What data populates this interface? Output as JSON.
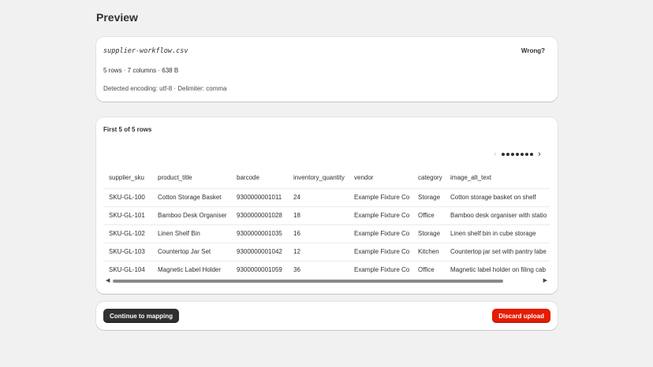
{
  "page": {
    "title": "Preview"
  },
  "file_card": {
    "filename": "supplier-workflow.csv",
    "wrong_label": "Wrong?",
    "summary": "5 rows · 7 columns · 638 B",
    "encoding": "Detected encoding: utf-8 · Delimiter: comma"
  },
  "preview_card": {
    "heading": "First 5 of 5 rows",
    "pager": {
      "prev_icon": "chevron-left-icon",
      "next_icon": "chevron-right-icon",
      "dot_count": 7
    },
    "columns": [
      "supplier_sku",
      "product_title",
      "barcode",
      "inventory_quantity",
      "vendor",
      "category",
      "image_alt_text"
    ],
    "rows": [
      [
        "SKU-GL-100",
        "Cotton Storage Basket",
        "9300000001011",
        "24",
        "Example Fixture Co",
        "Storage",
        "Cotton storage basket on shelf"
      ],
      [
        "SKU-GL-101",
        "Bamboo Desk Organiser",
        "9300000001028",
        "18",
        "Example Fixture Co",
        "Office",
        "Bamboo desk organiser with statio"
      ],
      [
        "SKU-GL-102",
        "Linen Shelf Bin",
        "9300000001035",
        "16",
        "Example Fixture Co",
        "Storage",
        "Linen shelf bin in cube storage"
      ],
      [
        "SKU-GL-103",
        "Countertop Jar Set",
        "9300000001042",
        "12",
        "Example Fixture Co",
        "Kitchen",
        "Countertop jar set with pantry labe"
      ],
      [
        "SKU-GL-104",
        "Magnetic Label Holder",
        "9300000001059",
        "36",
        "Example Fixture Co",
        "Office",
        "Magnetic label holder on filing cab"
      ]
    ],
    "scrollbar": {
      "left_icon": "arrow-left-icon",
      "right_icon": "arrow-right-icon"
    }
  },
  "actions": {
    "continue_label": "Continue to mapping",
    "discard_label": "Discard upload"
  },
  "colors": {
    "page_bg": "#f1f1f1",
    "primary_button": "#303030",
    "critical_button": "#e51c00"
  }
}
